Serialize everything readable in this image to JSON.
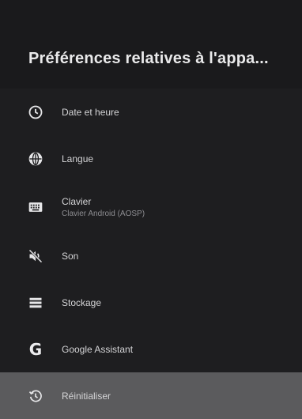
{
  "header": {
    "title": "Préférences relatives à l'appa..."
  },
  "menu": {
    "items": [
      {
        "label": "Date et heure",
        "icon": "clock-icon"
      },
      {
        "label": "Langue",
        "icon": "globe-icon"
      },
      {
        "label": "Clavier",
        "sublabel": "Clavier Android (AOSP)",
        "icon": "keyboard-icon"
      },
      {
        "label": "Son",
        "icon": "sound-off-icon"
      },
      {
        "label": "Stockage",
        "icon": "storage-icon"
      },
      {
        "label": "Google Assistant",
        "icon": "google-icon"
      },
      {
        "label": "Réinitialiser",
        "icon": "restore-icon",
        "selected": true
      }
    ]
  },
  "colors": {
    "background": "#1e1e20",
    "header_background": "#1a1a1c",
    "selected_background": "#5b5b5d",
    "title": "#e9e9ea",
    "text": "#d4d4d6",
    "subtext": "#8e8e92"
  }
}
